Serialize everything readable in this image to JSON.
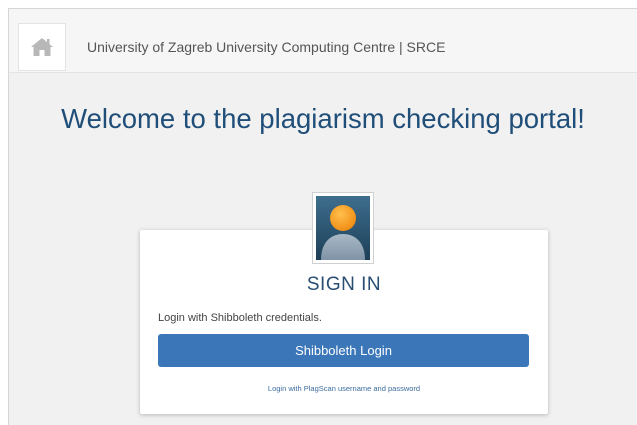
{
  "header": {
    "organization": "University of Zagreb University Computing Centre | SRCE",
    "home_icon": "home-icon"
  },
  "main": {
    "welcome_title": "Welcome to the plagiarism checking portal!"
  },
  "signin_card": {
    "avatar_icon": "user-avatar-icon",
    "title": "SIGN IN",
    "instruction": "Login with Shibboleth credentials.",
    "primary_button": "Shibboleth Login",
    "alt_login_link": "Login with PlagScan username and password"
  },
  "colors": {
    "primary_button": "#3a76b8",
    "title_blue": "#1f4e79",
    "avatar_head": "#f39a1f"
  }
}
